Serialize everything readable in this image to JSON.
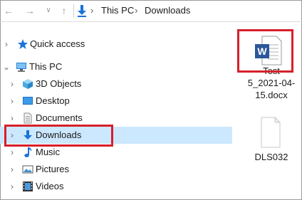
{
  "addressbar": {
    "back_icon": "arrow-left-icon",
    "forward_icon": "arrow-right-icon",
    "recent_icon": "chevron-down-icon",
    "up_icon": "arrow-up-icon",
    "breadcrumb": [
      "This PC",
      "Downloads"
    ]
  },
  "sidebar": {
    "items": [
      {
        "label": "Quick access",
        "icon": "star-icon"
      },
      {
        "label": "This PC",
        "icon": "computer-icon"
      },
      {
        "label": "3D Objects",
        "icon": "cube-icon"
      },
      {
        "label": "Desktop",
        "icon": "desktop-icon"
      },
      {
        "label": "Documents",
        "icon": "document-icon"
      },
      {
        "label": "Downloads",
        "icon": "download-arrow-icon"
      },
      {
        "label": "Music",
        "icon": "music-note-icon"
      },
      {
        "label": "Pictures",
        "icon": "picture-icon"
      },
      {
        "label": "Videos",
        "icon": "film-icon"
      }
    ]
  },
  "files": [
    {
      "name_line1": "Test",
      "name_line2": "5_2021-04-",
      "name_line3": "15.docx",
      "icon": "word-doc-icon",
      "icon_letter": "W"
    },
    {
      "name_line1": "DLS032",
      "icon": "blank-file-icon"
    }
  ],
  "colors": {
    "highlight": "#d71f2b",
    "selection": "#cce8ff",
    "word_blue": "#2b579a",
    "download_blue": "#1a73d9"
  }
}
